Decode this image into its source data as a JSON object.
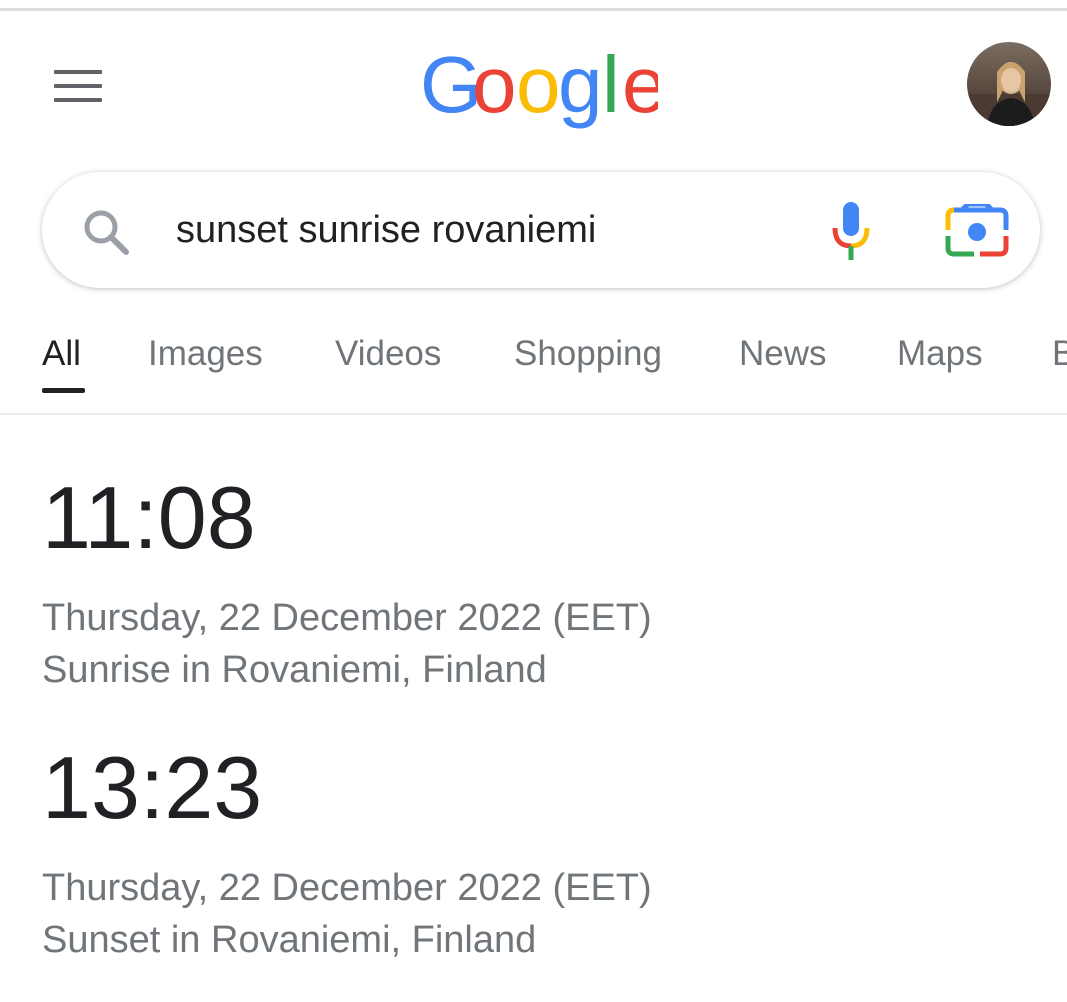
{
  "header": {
    "menu_icon": "hamburger-menu-icon",
    "logo_text": "Google",
    "logo_colors": [
      "#4285F4",
      "#EA4335",
      "#FBBC05",
      "#4285F4",
      "#34A853",
      "#EA4335"
    ],
    "avatar": "user-avatar"
  },
  "search": {
    "query": "sunset sunrise rovaniemi",
    "search_icon": "search-icon",
    "mic_icon": "microphone-icon",
    "lens_icon": "camera-lens-icon"
  },
  "tabs": [
    {
      "label": "All",
      "active": true
    },
    {
      "label": "Images",
      "active": false
    },
    {
      "label": "Videos",
      "active": false
    },
    {
      "label": "Shopping",
      "active": false
    },
    {
      "label": "News",
      "active": false
    },
    {
      "label": "Maps",
      "active": false
    },
    {
      "label": "Books",
      "active": false
    }
  ],
  "results": [
    {
      "time": "11:08",
      "date": "Thursday, 22 December 2022 (EET)",
      "label": "Sunrise in Rovaniemi, Finland"
    },
    {
      "time": "13:23",
      "date": "Thursday, 22 December 2022 (EET)",
      "label": "Sunset in Rovaniemi, Finland"
    }
  ],
  "colors": {
    "text_primary": "#202124",
    "text_secondary": "#70757a",
    "google_blue": "#4285F4",
    "google_red": "#EA4335",
    "google_yellow": "#FBBC05",
    "google_green": "#34A853"
  }
}
